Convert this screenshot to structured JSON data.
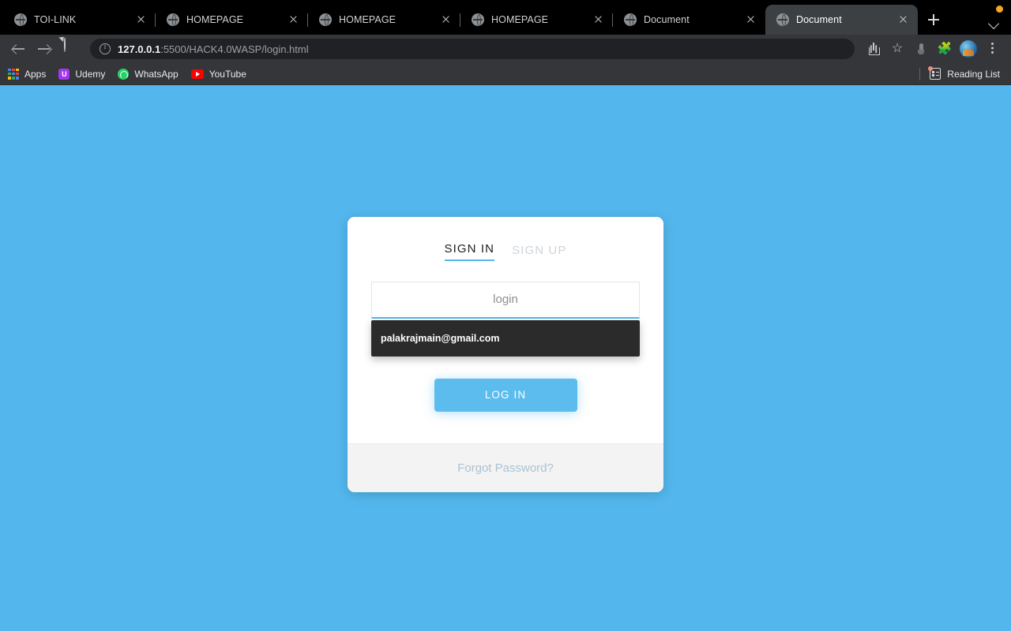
{
  "browser": {
    "tabs": [
      {
        "title": "TOI-LINK",
        "favicon": "globe-icon",
        "active": false
      },
      {
        "title": "HOMEPAGE",
        "favicon": "globe-icon",
        "active": false
      },
      {
        "title": "HOMEPAGE",
        "favicon": "globe-icon",
        "active": false
      },
      {
        "title": "HOMEPAGE",
        "favicon": "globe-icon",
        "active": false
      },
      {
        "title": "Document",
        "favicon": "globe-icon",
        "active": false
      },
      {
        "title": "Document",
        "favicon": "globe-icon",
        "active": true
      }
    ],
    "new_tab_label": "+",
    "tab_list_icon": "chevron-down-icon",
    "nav": {
      "back_icon": "arrow-left-icon",
      "forward_icon": "arrow-right-icon",
      "reload_icon": "reload-icon"
    },
    "omnibox": {
      "site_info_icon": "info-circle-icon",
      "url_host": "127.0.0.1",
      "url_path": ":5500/HACK4.0WASP/login.html",
      "full_url": "127.0.0.1:5500/HACK4.0WASP/login.html"
    },
    "toolbar_icons": [
      "share-icon",
      "star-icon",
      "cursor-icon",
      "extensions-puzzle-icon",
      "profile-avatar-icon",
      "more-vertical-icon"
    ],
    "bookmarks": [
      {
        "label": "Apps",
        "icon": "apps-grid-icon"
      },
      {
        "label": "Udemy",
        "icon": "udemy-icon"
      },
      {
        "label": "WhatsApp",
        "icon": "whatsapp-icon"
      },
      {
        "label": "YouTube",
        "icon": "youtube-icon"
      }
    ],
    "reading_list": {
      "label": "Reading List",
      "icon": "reading-list-icon"
    }
  },
  "page": {
    "background_color": "#53b7ed",
    "accent_color": "#53b7ed",
    "card": {
      "tabs": [
        {
          "label": "SIGN IN",
          "selected": true
        },
        {
          "label": "SIGN UP",
          "selected": false
        }
      ],
      "login_field": {
        "placeholder": "login",
        "value": ""
      },
      "autofill": {
        "suggestions": [
          "palakrajmain@gmail.com"
        ]
      },
      "submit_label": "LOG IN",
      "footer_link": "Forgot Password?"
    }
  }
}
